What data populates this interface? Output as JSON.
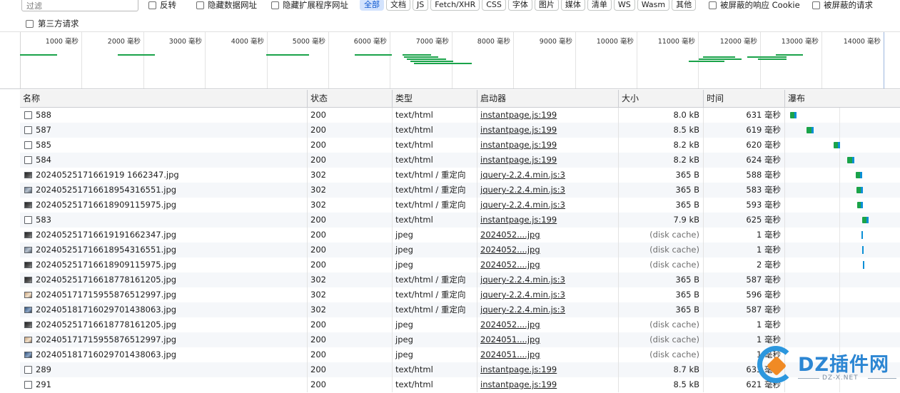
{
  "filter": {
    "placeholder": "过滤",
    "invert_label": "反转",
    "hide_data_urls_label": "隐藏数据网址",
    "hide_extension_urls_label": "隐藏扩展程序网址",
    "chips": [
      {
        "label": "全部",
        "active": true
      },
      {
        "label": "文档",
        "active": false
      },
      {
        "label": "JS",
        "active": false
      },
      {
        "label": "Fetch/XHR",
        "active": false
      },
      {
        "label": "CSS",
        "active": false
      },
      {
        "label": "字体",
        "active": false
      },
      {
        "label": "图片",
        "active": false
      },
      {
        "label": "媒体",
        "active": false
      },
      {
        "label": "清单",
        "active": false
      },
      {
        "label": "WS",
        "active": false
      },
      {
        "label": "Wasm",
        "active": false
      },
      {
        "label": "其他",
        "active": false
      }
    ],
    "blocked_cookies_label": "被屏蔽的响应 Cookie",
    "blocked_requests_label": "被屏蔽的请求",
    "third_party_label": "第三方请求"
  },
  "overview": {
    "ticks": [
      "1000 毫秒",
      "2000 毫秒",
      "3000 毫秒",
      "4000 毫秒",
      "5000 毫秒",
      "6000 毫秒",
      "7000 毫秒",
      "8000 毫秒",
      "9000 毫秒",
      "10000 毫秒",
      "11000 毫秒",
      "12000 毫秒",
      "13000 毫秒",
      "14000 毫秒"
    ]
  },
  "table": {
    "headers": {
      "name": "名称",
      "status": "状态",
      "type": "类型",
      "initiator": "启动器",
      "size": "大小",
      "time": "时间",
      "waterfall": "瀑布"
    },
    "rows": [
      {
        "icon": "doc",
        "name": "588",
        "status": "200",
        "type": "text/html",
        "initiator": "instantpage.js:199",
        "size": "8.0 kB",
        "time": "631 毫秒"
      },
      {
        "icon": "doc",
        "name": "587",
        "status": "200",
        "type": "text/html",
        "initiator": "instantpage.js:199",
        "size": "8.5 kB",
        "time": "619 毫秒"
      },
      {
        "icon": "doc",
        "name": "585",
        "status": "200",
        "type": "text/html",
        "initiator": "instantpage.js:199",
        "size": "8.2 kB",
        "time": "620 毫秒"
      },
      {
        "icon": "doc",
        "name": "584",
        "status": "200",
        "type": "text/html",
        "initiator": "instantpage.js:199",
        "size": "8.2 kB",
        "time": "624 毫秒"
      },
      {
        "icon": "img-dark",
        "name": "20240525171661919 1662347.jpg",
        "status": "302",
        "type": "text/html / 重定向",
        "initiator": "jquery-2.2.4.min.js:3",
        "size": "365 B",
        "time": "588 毫秒"
      },
      {
        "icon": "img-photo",
        "name": "202405251716618954316551.jpg",
        "status": "302",
        "type": "text/html / 重定向",
        "initiator": "jquery-2.2.4.min.js:3",
        "size": "365 B",
        "time": "583 毫秒"
      },
      {
        "icon": "img-dark",
        "name": "202405251716618909115975.jpg",
        "status": "302",
        "type": "text/html / 重定向",
        "initiator": "jquery-2.2.4.min.js:3",
        "size": "365 B",
        "time": "593 毫秒"
      },
      {
        "icon": "doc",
        "name": "583",
        "status": "200",
        "type": "text/html",
        "initiator": "instantpage.js:199",
        "size": "7.9 kB",
        "time": "625 毫秒"
      },
      {
        "icon": "img-dark",
        "name": "202405251716619191662347.jpg",
        "status": "200",
        "type": "jpeg",
        "initiator": "2024052....jpg",
        "size": "(disk cache)",
        "time": "1 毫秒"
      },
      {
        "icon": "img-photo",
        "name": "202405251716618954316551.jpg",
        "status": "200",
        "type": "jpeg",
        "initiator": "2024052....jpg",
        "size": "(disk cache)",
        "time": "1 毫秒"
      },
      {
        "icon": "img-dark",
        "name": "202405251716618909115975.jpg",
        "status": "200",
        "type": "jpeg",
        "initiator": "2024052....jpg",
        "size": "(disk cache)",
        "time": "2 毫秒"
      },
      {
        "icon": "img-dark",
        "name": "202405251716618778161205.jpg",
        "status": "302",
        "type": "text/html / 重定向",
        "initiator": "jquery-2.2.4.min.js:3",
        "size": "365 B",
        "time": "587 毫秒"
      },
      {
        "icon": "img-warm",
        "name": "202405171715955876512997.jpg",
        "status": "302",
        "type": "text/html / 重定向",
        "initiator": "jquery-2.2.4.min.js:3",
        "size": "365 B",
        "time": "596 毫秒"
      },
      {
        "icon": "img-blue",
        "name": "202405181716029701438063.jpg",
        "status": "302",
        "type": "text/html / 重定向",
        "initiator": "jquery-2.2.4.min.js:3",
        "size": "365 B",
        "time": "587 毫秒"
      },
      {
        "icon": "img-dark",
        "name": "202405251716618778161205.jpg",
        "status": "200",
        "type": "jpeg",
        "initiator": "2024052....jpg",
        "size": "(disk cache)",
        "time": "1 毫秒"
      },
      {
        "icon": "img-warm",
        "name": "202405171715955876512997.jpg",
        "status": "200",
        "type": "jpeg",
        "initiator": "2024051....jpg",
        "size": "(disk cache)",
        "time": "1 毫秒"
      },
      {
        "icon": "img-blue",
        "name": "202405181716029701438063.jpg",
        "status": "200",
        "type": "jpeg",
        "initiator": "2024051....jpg",
        "size": "(disk cache)",
        "time": "1 毫秒"
      },
      {
        "icon": "doc",
        "name": "289",
        "status": "200",
        "type": "text/html",
        "initiator": "instantpage.js:199",
        "size": "8.7 kB",
        "time": "633 毫秒"
      },
      {
        "icon": "doc",
        "name": "291",
        "status": "200",
        "type": "text/html",
        "initiator": "instantpage.js:199",
        "size": "8.5 kB",
        "time": "621 毫秒"
      }
    ]
  },
  "watermark": {
    "brand": "DZ插件网",
    "domain": "DZ-X.NET"
  },
  "colors": {
    "active_chip_bg": "#d3e3fd",
    "active_chip_text": "#0b57d0",
    "waiting_bar": "#1aa34a",
    "download_bar": "#0b8fd6"
  }
}
